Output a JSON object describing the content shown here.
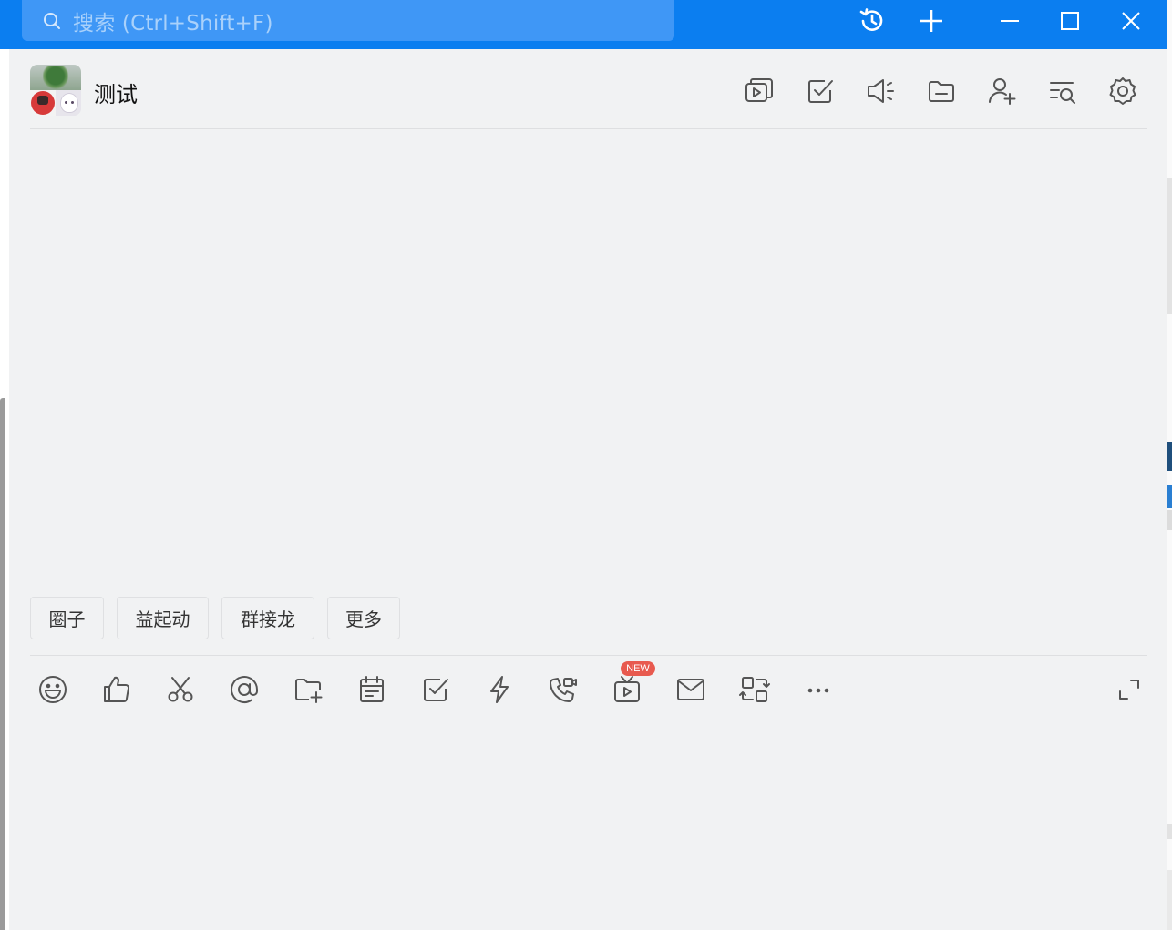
{
  "search": {
    "placeholder": "搜索 (Ctrl+Shift+F)"
  },
  "titlebar": {
    "icons": [
      "history-icon",
      "plus-icon",
      "minimize-icon",
      "maximize-icon",
      "close-icon"
    ],
    "background_color": "#0b7ef0"
  },
  "chat": {
    "title": "测试",
    "header_icons": [
      "video-icon",
      "todo-check-icon",
      "announcement-icon",
      "folder-icon",
      "add-member-icon",
      "search-history-icon",
      "settings-icon"
    ]
  },
  "quick_actions": [
    "圈子",
    "益起动",
    "群接龙",
    "更多"
  ],
  "toolbar": {
    "icons": [
      "emoji-icon",
      "thumbs-up-icon",
      "scissors-icon",
      "mention-icon",
      "folder-add-icon",
      "calendar-icon",
      "checkbox-icon",
      "lightning-icon",
      "phone-video-icon",
      "live-tv-icon",
      "mail-icon",
      "screen-share-icon",
      "more-icon",
      "expand-icon"
    ],
    "new_badge": "NEW",
    "badge_color": "#e85a4f"
  }
}
